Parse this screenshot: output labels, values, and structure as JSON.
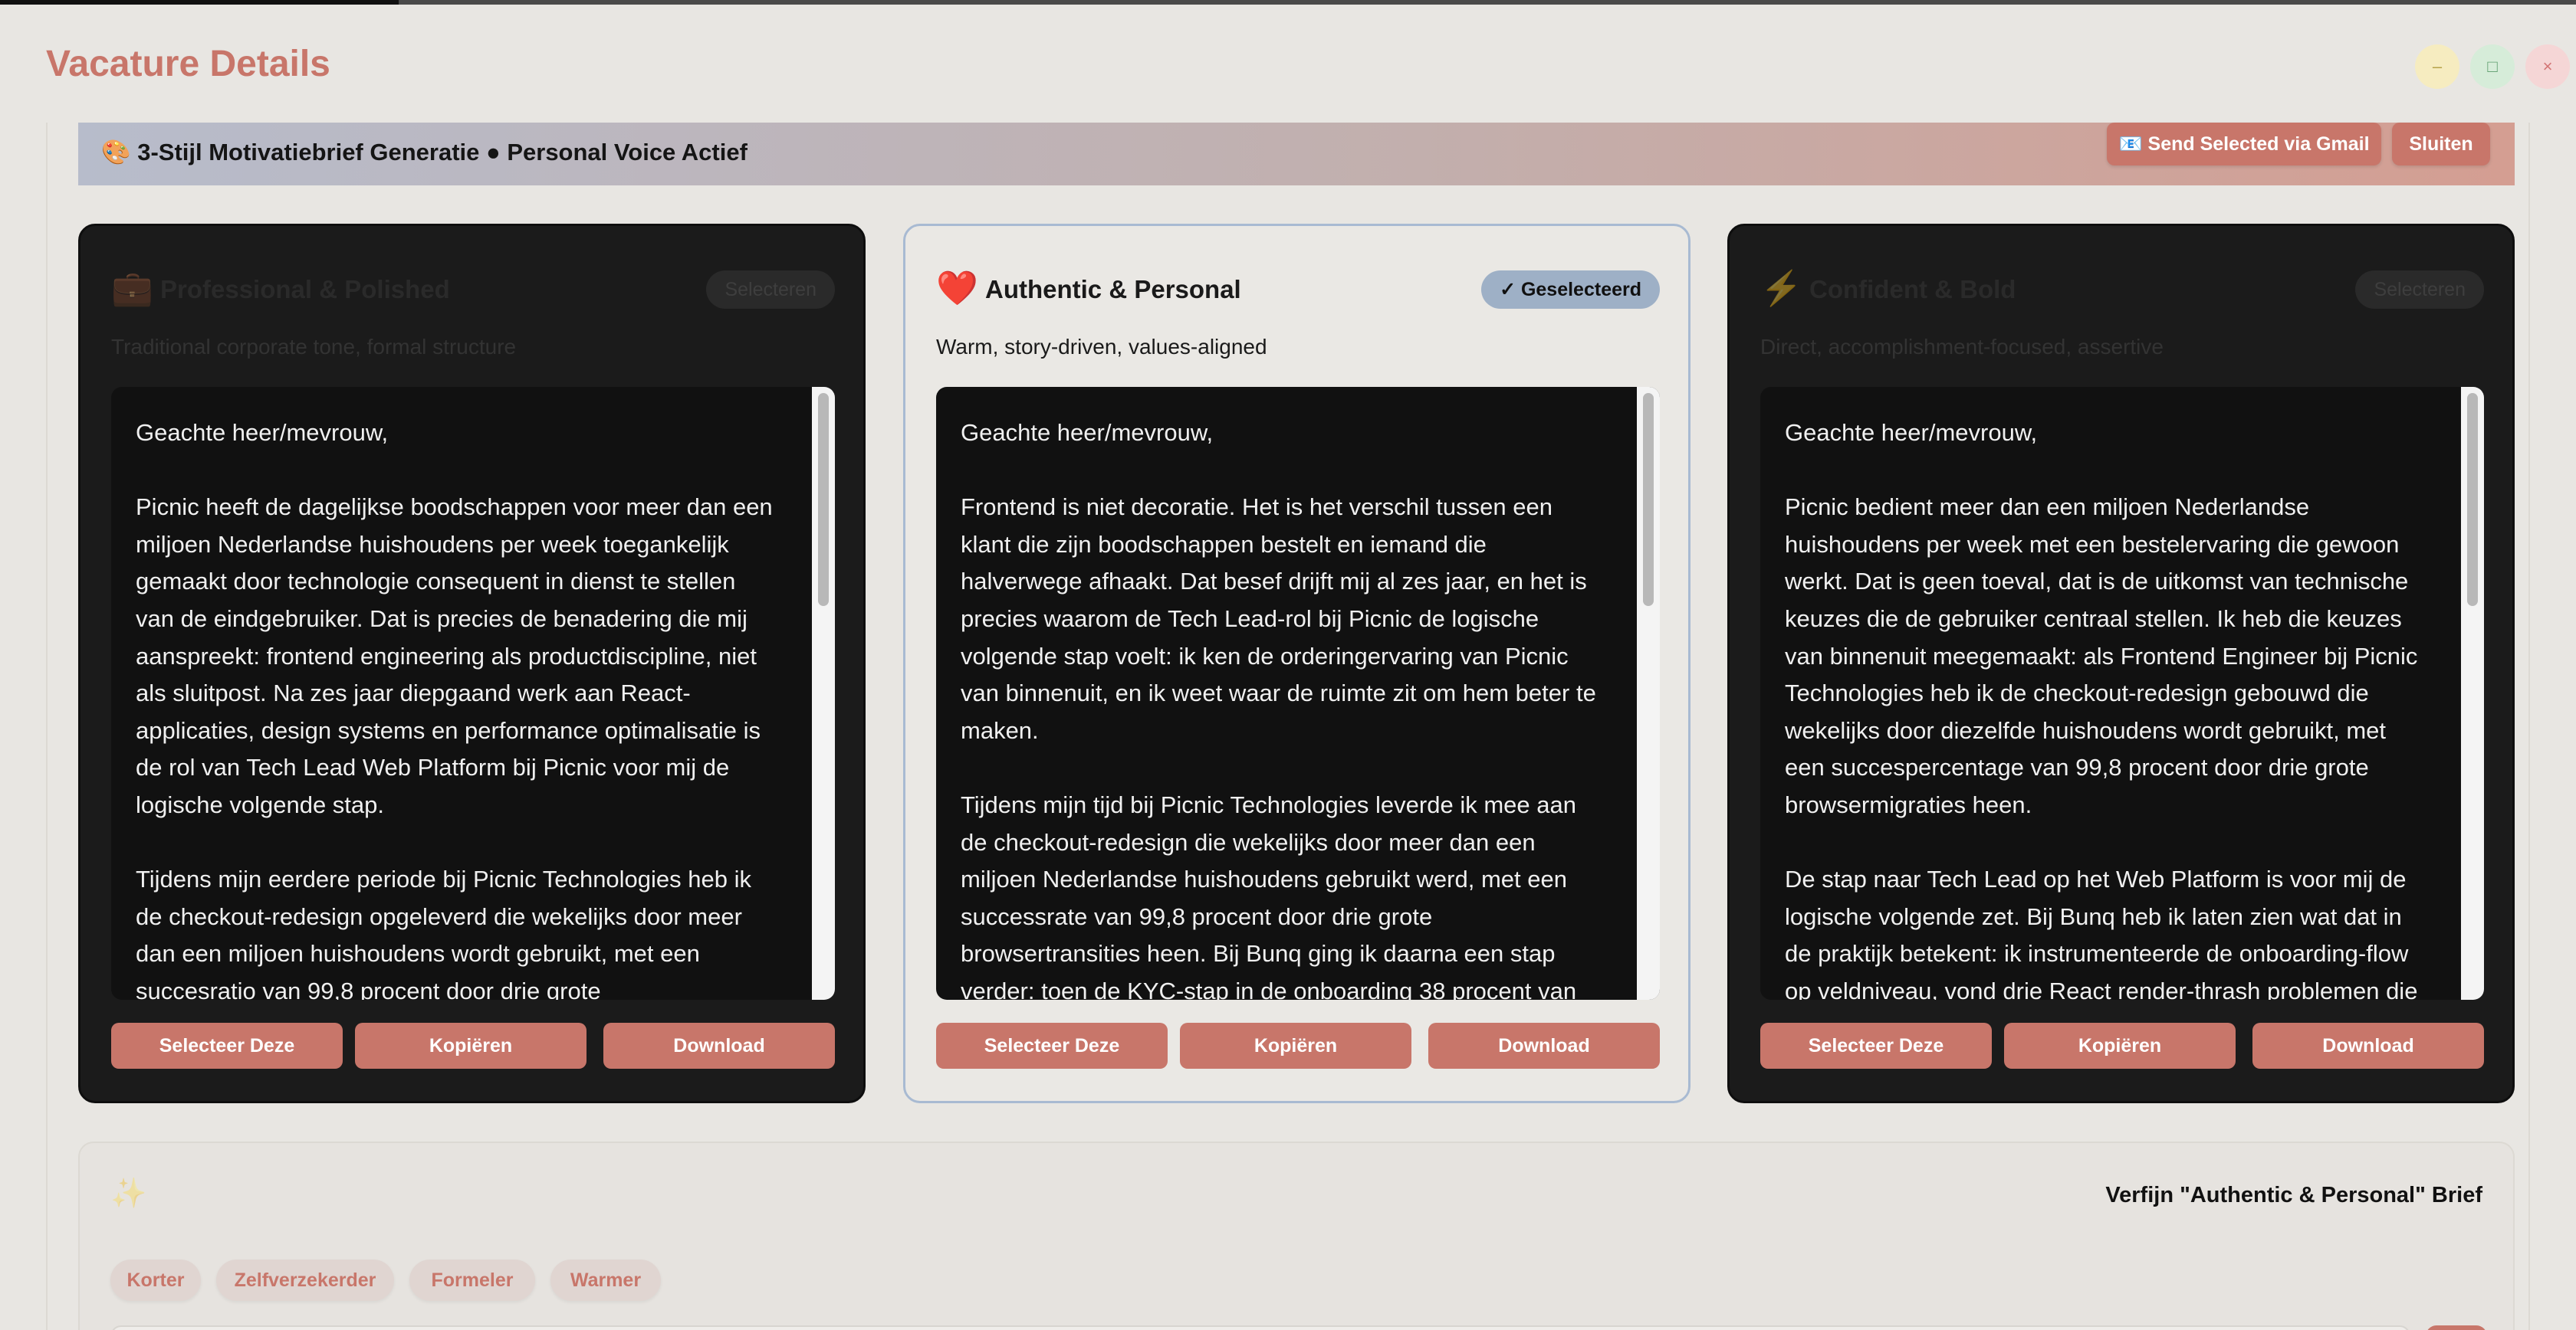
{
  "window": {
    "title": "Vacature Details",
    "controls": {
      "minimize": "–",
      "maximize": "□",
      "close": "×"
    }
  },
  "banner": {
    "title": "🎨 3-Stijl Motivatiebrief Generatie ● Personal Voice Actief",
    "send_gmail_label": "📧 Send Selected via Gmail",
    "close_label": "Sluiten"
  },
  "cards": [
    {
      "icon": "💼",
      "icon_name": "briefcase-icon",
      "title": "Professional & Polished",
      "subtitle": "Traditional corporate tone, formal structure",
      "select_label": "Selecteren",
      "selected": false,
      "letter": "Geachte heer/mevrouw,\n\nPicnic heeft de dagelijkse boodschappen voor meer dan een miljoen Nederlandse huishoudens per week toegankelijk gemaakt door technologie consequent in dienst te stellen van de eindgebruiker. Dat is precies de benadering die mij aanspreekt: frontend engineering als productdiscipline, niet als sluitpost. Na zes jaar diepgaand werk aan React-applicaties, design systems en performance optimalisatie is de rol van Tech Lead Web Platform bij Picnic voor mij de logische volgende stap.\n\nTijdens mijn eerdere periode bij Picnic Technologies heb ik de checkout-redesign opgeleverd die wekelijks door meer dan een miljoen huishoudens wordt gebruikt, met een succesratio van 99,8 procent door drie grote",
      "actions": {
        "select": "Selecteer Deze",
        "copy": "Kopiëren",
        "download": "Download"
      }
    },
    {
      "icon": "❤️",
      "icon_name": "heart-icon",
      "title": "Authentic & Personal",
      "subtitle": "Warm, story-driven, values-aligned",
      "select_label": "✓ Geselecteerd",
      "selected": true,
      "letter": "Geachte heer/mevrouw,\n\nFrontend is niet decoratie. Het is het verschil tussen een klant die zijn boodschappen bestelt en iemand die halverwege afhaakt. Dat besef drijft mij al zes jaar, en het is precies waarom de Tech Lead-rol bij Picnic de logische volgende stap voelt: ik ken de orderingervaring van Picnic van binnenuit, en ik weet waar de ruimte zit om hem beter te maken.\n\nTijdens mijn tijd bij Picnic Technologies leverde ik mee aan de checkout-redesign die wekelijks door meer dan een miljoen Nederlandse huishoudens gebruikt werd, met een successrate van 99,8 procent door drie grote browsertransities heen. Bij Bunq ging ik daarna een stap verder: toen de KYC-stap in de onboarding 38 procent van",
      "actions": {
        "select": "Selecteer Deze",
        "copy": "Kopiëren",
        "download": "Download"
      }
    },
    {
      "icon": "⚡",
      "icon_name": "lightning-icon",
      "title": "Confident & Bold",
      "subtitle": "Direct, accomplishment-focused, assertive",
      "select_label": "Selecteren",
      "selected": false,
      "letter": "Geachte heer/mevrouw,\n\nPicnic bedient meer dan een miljoen Nederlandse huishoudens per week met een bestelervaring die gewoon werkt. Dat is geen toeval, dat is de uitkomst van technische keuzes die de gebruiker centraal stellen. Ik heb die keuzes van binnenuit meegemaakt: als Frontend Engineer bij Picnic Technologies heb ik de checkout-redesign gebouwd die wekelijks door diezelfde huishoudens wordt gebruikt, met een succespercentage van 99,8 procent door drie grote browsermigraties heen.\n\nDe stap naar Tech Lead op het Web Platform is voor mij de logische volgende zet. Bij Bunq heb ik laten zien wat dat in de praktijk betekent: ik instrumenteerde de onboarding-flow op veldniveau, vond drie React render-thrash problemen die",
      "actions": {
        "select": "Selecteer Deze",
        "copy": "Kopiëren",
        "download": "Download"
      }
    }
  ],
  "refine": {
    "icon": "✨",
    "title": "Verfijn \"Authentic & Personal\" Brief",
    "chips": [
      "Korter",
      "Zelfverzekerder",
      "Formeler",
      "Warmer"
    ]
  }
}
